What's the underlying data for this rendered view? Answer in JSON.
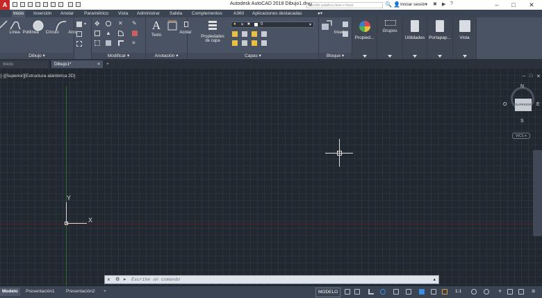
{
  "title_bar": {
    "logo": "A",
    "title": "Autodesk AutoCAD 2018    Dibujo1.dwg",
    "search_placeholder": "Escribir palabra clave o frase",
    "signin": "Iniciar sesión"
  },
  "menu_tabs": [
    "Inicio",
    "Inserción",
    "Anotar",
    "Paramétrico",
    "Vista",
    "Administrar",
    "Salida",
    "Complementos",
    "A360",
    "Aplicaciones destacadas"
  ],
  "ribbon": {
    "dibujo": {
      "title": "Dibujo",
      "tools": [
        "Línea",
        "Polilínea",
        "Círculo",
        "Arco"
      ]
    },
    "modificar": {
      "title": "Modificar"
    },
    "anotacion": {
      "title": "Anotación",
      "tools": [
        "Texto",
        "Acotar"
      ]
    },
    "capas": {
      "title": "Capas",
      "props_label_1": "Propiedades",
      "props_label_2": "de capa",
      "layer_value": "0"
    },
    "bloque": {
      "title": "Bloque",
      "insert": "Insertar"
    },
    "propiedades": "Propied...",
    "grupos": "Grupos",
    "utilidades": "Utilidades",
    "portapapeles": "Portapap...",
    "vista": "Vista"
  },
  "doc_tabs": [
    "Inicio",
    "Dibujo1*"
  ],
  "viewport": {
    "label": "[-][Superior][Estructura alámbrica 2D]",
    "ucs_x": "X",
    "ucs_y": "Y",
    "viewcube": {
      "n": "N",
      "s": "S",
      "e": "E",
      "o": "O",
      "face": "SUPERIOR",
      "wcs": "WCS"
    }
  },
  "command_line": {
    "placeholder": "Escribe un comando"
  },
  "status": {
    "layout_tabs": [
      "Modelo",
      "Presentación1",
      "Presentación2"
    ],
    "model": "MODELO",
    "scale": "1:1"
  },
  "colors": {
    "background": "#212830",
    "ribbon": "#4a5363",
    "menubar": "#3b4453",
    "axis_x": "#8b2020",
    "axis_y": "#2f6a2f"
  }
}
